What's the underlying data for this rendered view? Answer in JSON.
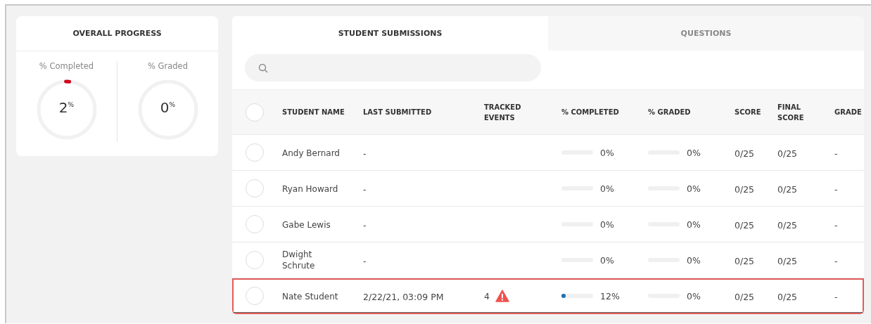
{
  "overall_progress": {
    "title": "OVERALL PROGRESS",
    "metrics": [
      {
        "label": "% Completed",
        "value": "2",
        "unit": "%",
        "level": 0.02
      },
      {
        "label": "% Graded",
        "value": "0",
        "unit": "%",
        "level": 0
      }
    ]
  },
  "tabs": [
    {
      "label": "STUDENT SUBMISSIONS",
      "selected": true
    },
    {
      "label": "QUESTIONS",
      "selected": false
    }
  ],
  "table": {
    "select_all_checked": false,
    "columns": [
      "STUDENT NAME",
      "LAST SUBMITTED",
      "TRACKED EVENTS",
      "% COMPLETED",
      "% GRADED",
      "SCORE",
      "FINAL SCORE",
      "GRADE"
    ],
    "rows": [
      {
        "checked": false,
        "highlighted": false,
        "name": "Andy Bernard",
        "last_submitted": "-",
        "warning": false,
        "completed": {
          "level": 0,
          "reading": "0%"
        },
        "graded": {
          "level": 0,
          "reading": "0%"
        },
        "score": "0/25",
        "final_score": "0/25",
        "grade": "-"
      },
      {
        "checked": false,
        "highlighted": false,
        "name": "Ryan Howard",
        "last_submitted": "-",
        "warning": false,
        "completed": {
          "level": 0,
          "reading": "0%"
        },
        "graded": {
          "level": 0,
          "reading": "0%"
        },
        "score": "0/25",
        "final_score": "0/25",
        "grade": "-"
      },
      {
        "checked": false,
        "highlighted": false,
        "name": "Gabe Lewis",
        "last_submitted": "-",
        "warning": false,
        "completed": {
          "level": 0,
          "reading": "0%"
        },
        "graded": {
          "level": 0,
          "reading": "0%"
        },
        "score": "0/25",
        "final_score": "0/25",
        "grade": "-"
      },
      {
        "checked": false,
        "highlighted": false,
        "name": "Dwight Schrute",
        "last_submitted": "-",
        "warning": false,
        "completed": {
          "level": 0,
          "reading": "0%"
        },
        "graded": {
          "level": 0,
          "reading": "0%"
        },
        "score": "0/25",
        "final_score": "0/25",
        "grade": "-"
      },
      {
        "checked": false,
        "highlighted": true,
        "name": "Nate Student",
        "last_submitted": "2/22/21, 03:09 PM",
        "tracked_events": "4",
        "warning": true,
        "completed": {
          "level": 0.12,
          "reading": "12%"
        },
        "graded": {
          "level": 0,
          "reading": "0%"
        },
        "score": "0/25",
        "final_score": "0/25",
        "grade": "-"
      }
    ]
  }
}
